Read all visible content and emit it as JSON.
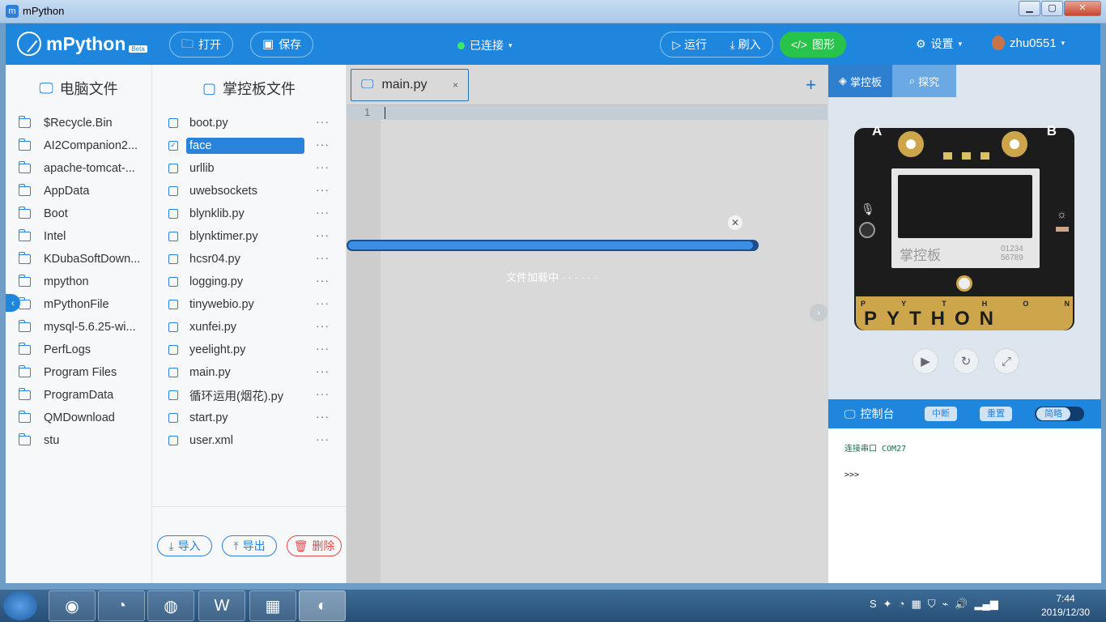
{
  "window": {
    "title": "mPython",
    "minimize": "▁",
    "maximize": "▢",
    "close": "✕"
  },
  "header": {
    "logo": "mPython",
    "beta": "Beta",
    "open": "打开",
    "save": "保存",
    "status": "已连接",
    "run": "运行",
    "flash": "刷入",
    "graphic": "图形",
    "settings": "设置",
    "user": "zhu0551"
  },
  "pc_files": {
    "title": "电脑文件",
    "items": [
      "$Recycle.Bin",
      "AI2Companion2...",
      "apache-tomcat-...",
      "AppData",
      "Boot",
      "Intel",
      "KDubaSoftDown...",
      "mpython",
      "mPythonFile",
      "mysql-5.6.25-wi...",
      "PerfLogs",
      "Program Files",
      "ProgramData",
      "QMDownload",
      "stu"
    ]
  },
  "board_files": {
    "title": "掌控板文件",
    "items": [
      "boot.py",
      "face",
      "urllib",
      "uwebsockets",
      "blynklib.py",
      "blynktimer.py",
      "hcsr04.py",
      "logging.py",
      "tinywebio.py",
      "xunfei.py",
      "yeelight.py",
      "main.py",
      "循环运用(烟花).py",
      "start.py",
      "user.xml"
    ],
    "selected_index": 1,
    "more": "···",
    "import": "导入",
    "export": "导出",
    "delete": "删除"
  },
  "editor": {
    "tab": "main.py",
    "tab_close": "×",
    "add": "+",
    "line_number": "1"
  },
  "progress": {
    "text": "文件加载中 · · · · · ·",
    "value": 0.99,
    "close": "✕"
  },
  "right_panel": {
    "tab_board": "掌控板",
    "tab_explore": "探究",
    "board": {
      "label_a": "A",
      "label_b": "B",
      "brand": "掌控板",
      "num1": "01234",
      "num2": "56789",
      "letters": [
        "P",
        "Y",
        "T",
        "H",
        "O",
        "N"
      ],
      "logo": "PYTHON"
    },
    "console": {
      "title": "控制台",
      "interrupt": "中断",
      "reset": "重置",
      "simple": "简略",
      "line1": "连接串口 COM27",
      "line2": ">>>"
    }
  },
  "taskbar": {
    "time": "7:44",
    "date": "2019/12/30"
  },
  "colors": {
    "accent": "#1f86de",
    "connected": "#3be86a",
    "graphic_btn": "#28c34a",
    "delete": "#e24a4a"
  }
}
